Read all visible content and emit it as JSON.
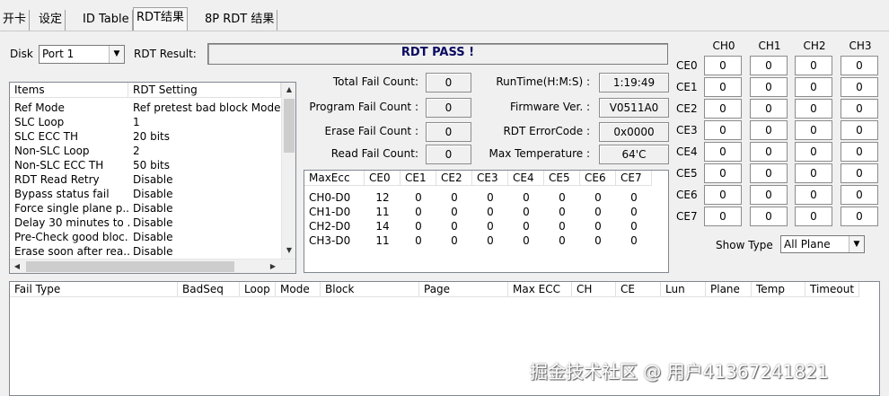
{
  "tabs": [
    "开卡",
    "设定",
    "ID Table",
    "RDT结果",
    "8P RDT 结果"
  ],
  "disk": {
    "label": "Disk",
    "value": "Port 1"
  },
  "rdt_result": {
    "label": "RDT Result:",
    "value": "RDT PASS !"
  },
  "settings": {
    "headers": [
      "Items",
      "RDT Setting"
    ],
    "rows": [
      [
        "Ref Mode",
        "Ref pretest bad block Mode"
      ],
      [
        "SLC Loop",
        "1"
      ],
      [
        "SLC ECC TH",
        "20 bits"
      ],
      [
        "Non-SLC Loop",
        "2"
      ],
      [
        "Non-SLC ECC TH",
        "50 bits"
      ],
      [
        "RDT Read Retry",
        "Disable"
      ],
      [
        "Bypass status fail",
        "Disable"
      ],
      [
        "Force single plane p...",
        "Disable"
      ],
      [
        "Delay 30 minutes to ...",
        "Disable"
      ],
      [
        "Pre-Check good bloc...",
        "Disable"
      ],
      [
        "Erase soon after rea...",
        "Disable"
      ]
    ]
  },
  "fail_counts": [
    {
      "label": "Total Fail Count:",
      "value": "0"
    },
    {
      "label": "Program Fail Count :",
      "value": "0"
    },
    {
      "label": "Erase Fail Count :",
      "value": "0"
    },
    {
      "label": "Read Fail Count:",
      "value": "0"
    }
  ],
  "info": [
    {
      "label": "RunTime(H:M:S) :",
      "value": "1:19:49"
    },
    {
      "label": "Firmware Ver. :",
      "value": "V0511A0"
    },
    {
      "label": "RDT ErrorCode :",
      "value": "0x0000"
    },
    {
      "label": "Max Temperature :",
      "value": "64'C"
    }
  ],
  "ecc": {
    "headers": [
      "MaxEcc",
      "CE0",
      "CE1",
      "CE2",
      "CE3",
      "CE4",
      "CE5",
      "CE6",
      "CE7"
    ],
    "rows": [
      [
        "CH0-D0",
        "12",
        "0",
        "0",
        "0",
        "0",
        "0",
        "0",
        "0"
      ],
      [
        "CH1-D0",
        "11",
        "0",
        "0",
        "0",
        "0",
        "0",
        "0",
        "0"
      ],
      [
        "CH2-D0",
        "14",
        "0",
        "0",
        "0",
        "0",
        "0",
        "0",
        "0"
      ],
      [
        "CH3-D0",
        "11",
        "0",
        "0",
        "0",
        "0",
        "0",
        "0",
        "0"
      ]
    ]
  },
  "grid": {
    "channels": [
      "CH0",
      "CH1",
      "CH2",
      "CH3"
    ],
    "ces": [
      "CE0",
      "CE1",
      "CE2",
      "CE3",
      "CE4",
      "CE5",
      "CE6",
      "CE7"
    ],
    "value": "0"
  },
  "show_type": {
    "label": "Show Type",
    "value": "All Plane"
  },
  "fail_table": {
    "headers": [
      "Fail Type",
      "BadSeq",
      "Loop",
      "Mode",
      "Block",
      "Page",
      "Max ECC",
      "CH",
      "CE",
      "Lun",
      "Plane",
      "Temp",
      "Timeout"
    ]
  },
  "watermark": "掘金技术社区 @ 用户41367241821"
}
